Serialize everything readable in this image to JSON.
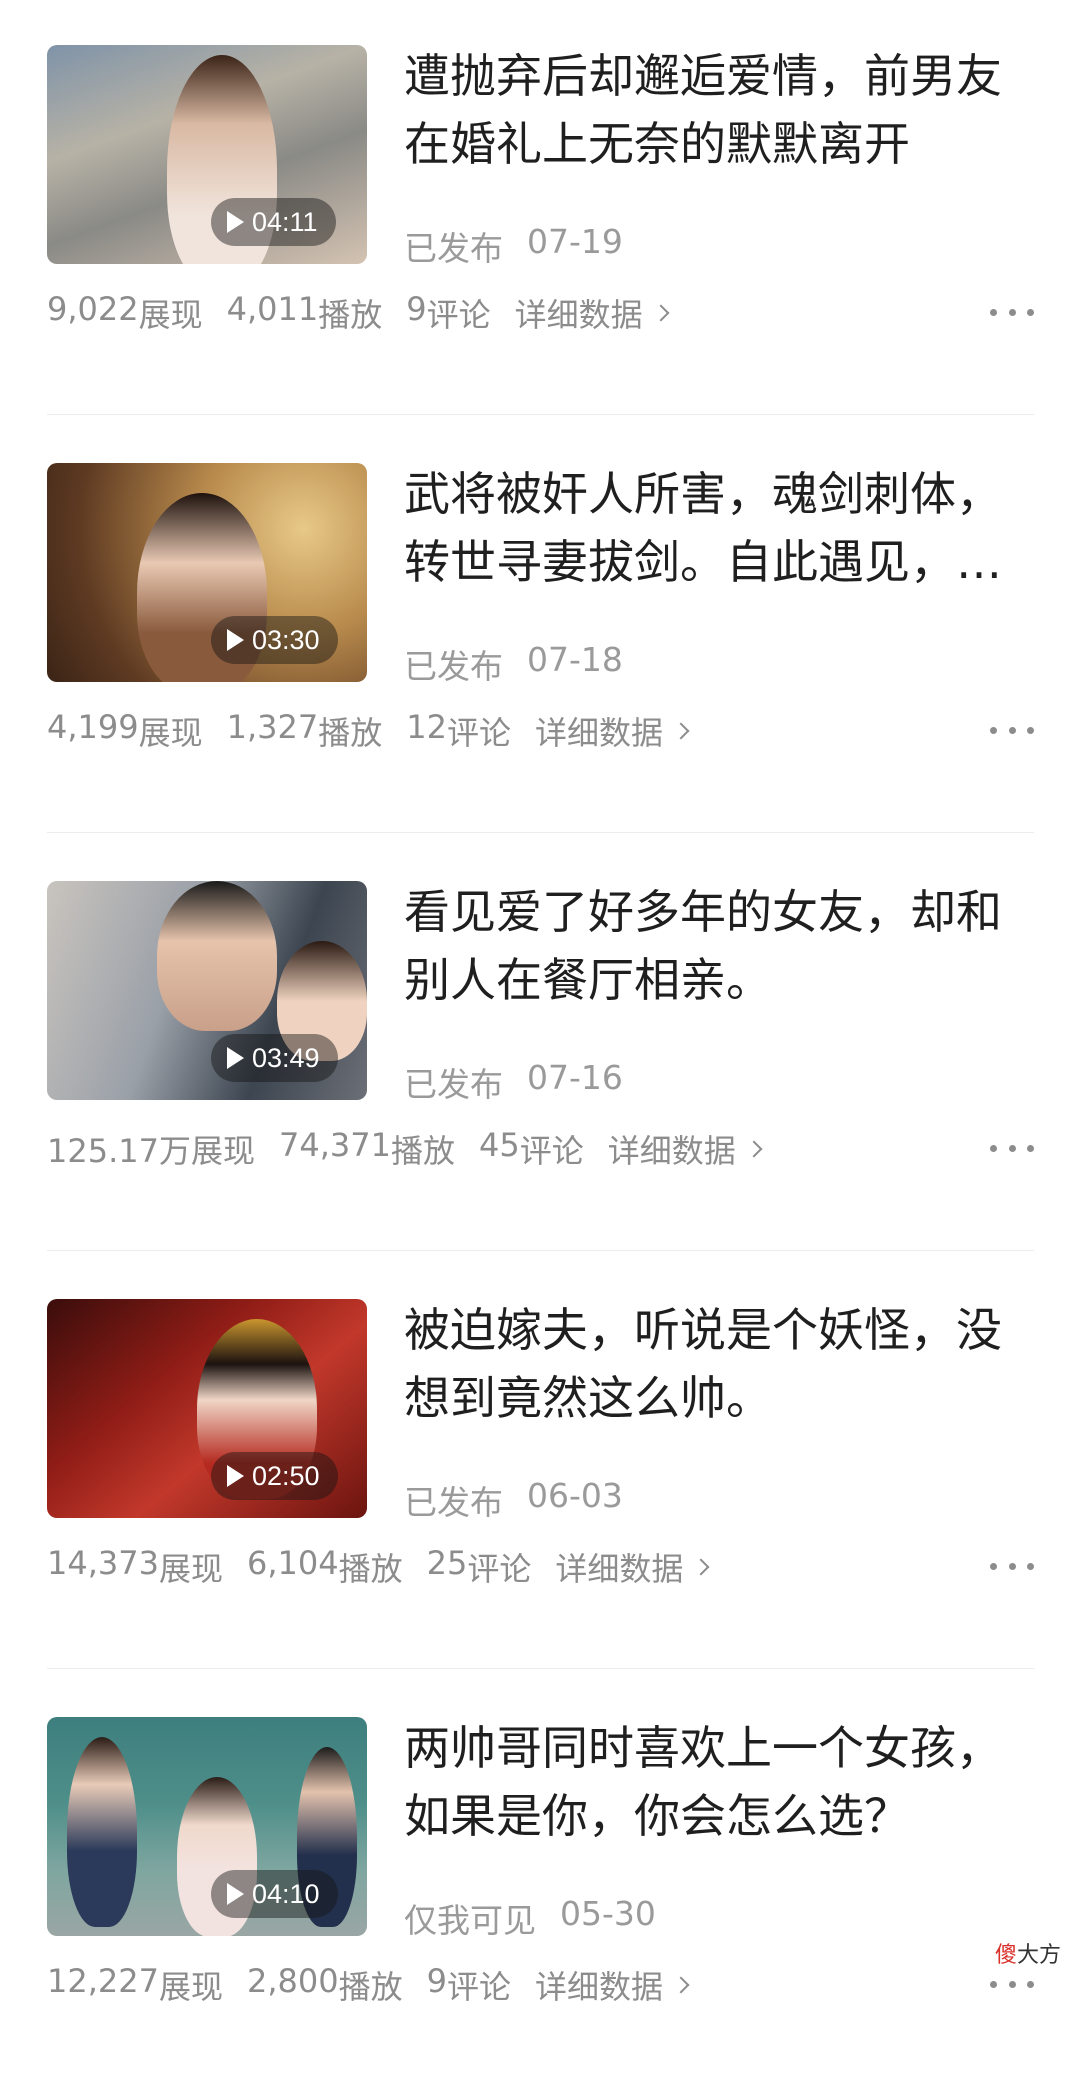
{
  "videos": [
    {
      "title": "遭抛弃后却邂逅爱情，前男友在婚礼上无奈的默默离开",
      "duration": "04:11",
      "status": "已发布",
      "date": "07-19",
      "impressions": "9,022",
      "impressions_label": "展现",
      "plays": "4,011",
      "plays_label": "播放",
      "comments": "9",
      "comments_label": "评论",
      "detail_label": "详细数据"
    },
    {
      "title": "武将被奸人所害，魂剑刺体，转世寻妻拔剑。自此遇见，…",
      "duration": "03:30",
      "status": "已发布",
      "date": "07-18",
      "impressions": "4,199",
      "impressions_label": "展现",
      "plays": "1,327",
      "plays_label": "播放",
      "comments": "12",
      "comments_label": "评论",
      "detail_label": "详细数据"
    },
    {
      "title": "看见爱了好多年的女友，却和别人在餐厅相亲。",
      "duration": "03:49",
      "status": "已发布",
      "date": "07-16",
      "impressions": "125.17万",
      "impressions_label": "展现",
      "plays": "74,371",
      "plays_label": "播放",
      "comments": "45",
      "comments_label": "评论",
      "detail_label": "详细数据"
    },
    {
      "title": "被迫嫁夫，听说是个妖怪，没想到竟然这么帅。",
      "duration": "02:50",
      "status": "已发布",
      "date": "06-03",
      "impressions": "14,373",
      "impressions_label": "展现",
      "plays": "6,104",
      "plays_label": "播放",
      "comments": "25",
      "comments_label": "评论",
      "detail_label": "详细数据"
    },
    {
      "title": "两帅哥同时喜欢上一个女孩，如果是你，你会怎么选？",
      "duration": "04:10",
      "status": "仅我可见",
      "date": "05-30",
      "impressions": "12,227",
      "impressions_label": "展现",
      "plays": "2,800",
      "plays_label": "播放",
      "comments": "9",
      "comments_label": "评论",
      "detail_label": "详细数据"
    }
  ],
  "watermark": {
    "accent": "傻",
    "rest": "大方"
  },
  "colors": {
    "meta_text": "#8c8c8c",
    "title_text": "#1f1f1f",
    "divider": "#ececec"
  }
}
